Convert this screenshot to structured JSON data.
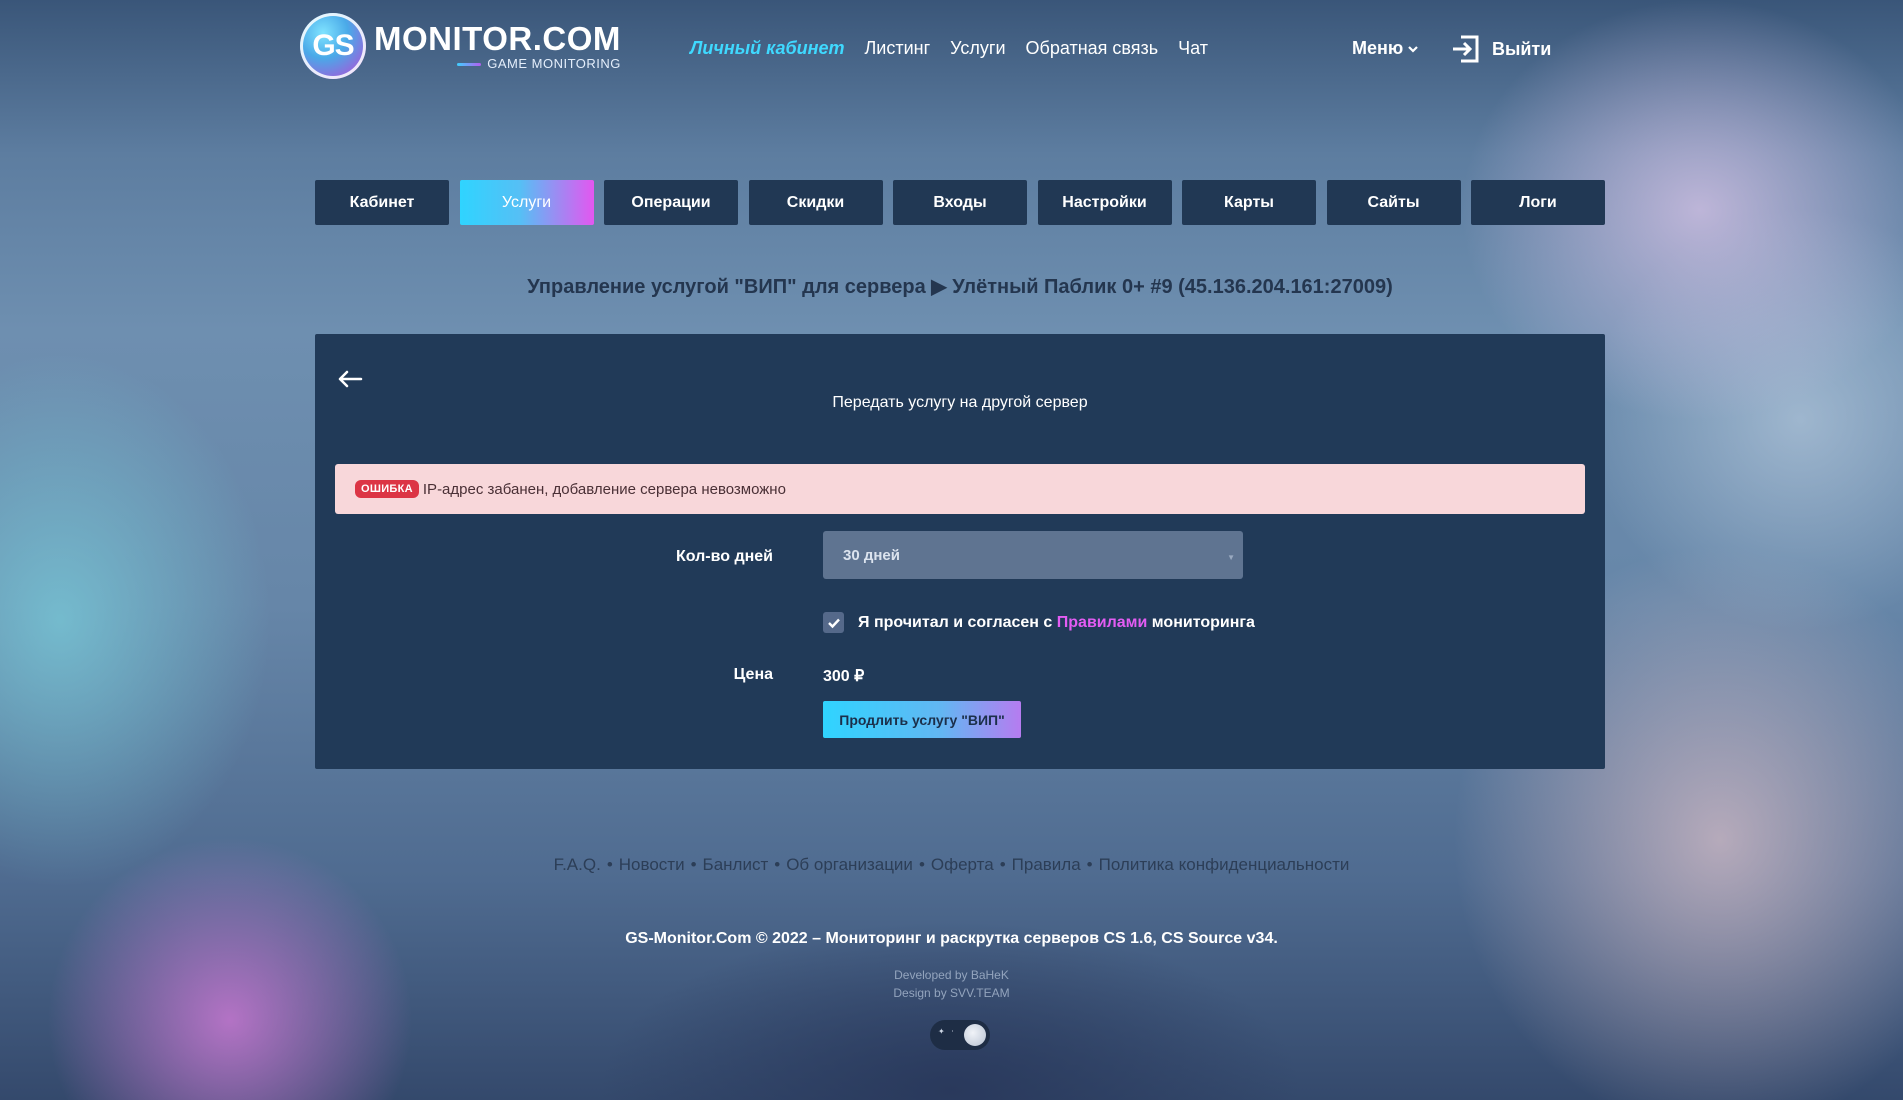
{
  "header": {
    "logo_badge": "GS",
    "logo_title": "MONITOR.COM",
    "logo_subtitle": "GAME MONITORING",
    "nav": [
      {
        "label": "Личный кабинет"
      },
      {
        "label": "Листинг"
      },
      {
        "label": "Услуги"
      },
      {
        "label": "Обратная связь"
      },
      {
        "label": "Чат"
      }
    ],
    "menu_label": "Меню",
    "logout_label": "Выйти"
  },
  "tabs": [
    {
      "label": "Кабинет"
    },
    {
      "label": "Услуги"
    },
    {
      "label": "Операции"
    },
    {
      "label": "Скидки"
    },
    {
      "label": "Входы"
    },
    {
      "label": "Настройки"
    },
    {
      "label": "Карты"
    },
    {
      "label": "Сайты"
    },
    {
      "label": "Логи"
    }
  ],
  "page_heading": "Управление услугой \"ВИП\" для сервера ▶ Улётный Паблик 0+ #9 (45.136.204.161:27009)",
  "card": {
    "title": "Передать услугу на другой сервер",
    "alert_badge": "ОШИБКА",
    "alert_text": "IP-адрес забанен, добавление сервера невозможно",
    "days_label": "Кол-во дней",
    "days_value": "30 дней",
    "agree_prefix": "Я прочитал и согласен с",
    "agree_link": "Правилами",
    "agree_suffix": "мониторинга",
    "price_label": "Цена",
    "price_value": "300 ₽",
    "renew_button": "Продлить услугу \"ВИП\""
  },
  "footer": {
    "links": [
      {
        "label": "F.A.Q."
      },
      {
        "label": "Новости"
      },
      {
        "label": "Банлист"
      },
      {
        "label": "Об организации"
      },
      {
        "label": "Оферта"
      },
      {
        "label": "Правила"
      },
      {
        "label": "Политика конфиденциальности"
      }
    ],
    "separator": "•",
    "copyright": "GS-Monitor.Com © 2022 – Мониторинг и раскрутка серверов CS 1.6, CS Source v34.",
    "developed_by": "Developed by BaHeK",
    "design_by": "Design by SVV.TEAM"
  },
  "colors": {
    "accent_cyan": "#2fd4ff",
    "accent_magenta": "#e357f0",
    "panel": "#213a58",
    "alert_bg": "#f8d7da",
    "alert_badge": "#dc3545"
  }
}
